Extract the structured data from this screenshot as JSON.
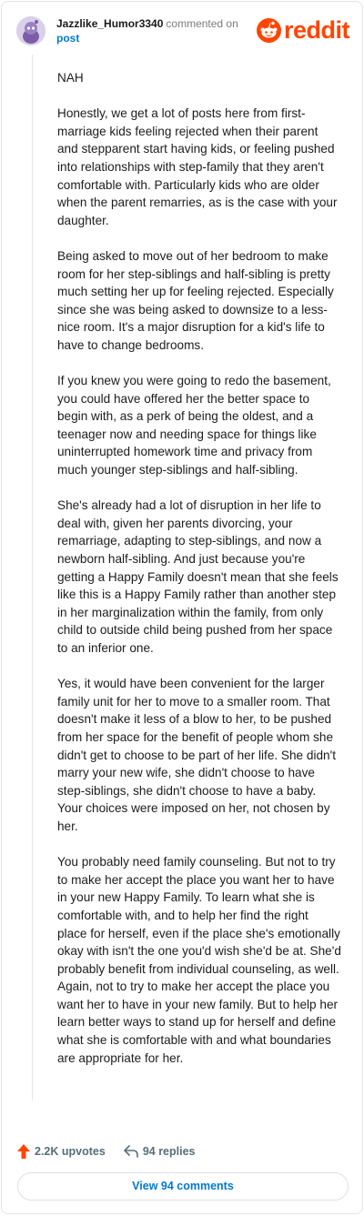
{
  "header": {
    "username": "Jazzlike_Humor3340",
    "commented_text": "commented on",
    "post_link": "post",
    "logo_text": "reddit"
  },
  "comment": {
    "paragraphs": [
      "NAH",
      "Honestly, we get a lot of posts here from first-marriage kids feeling rejected when their parent and stepparent start having kids, or feeling pushed into relationships with step-family that they aren't comfortable with. Particularly kids who are older when the parent remarries, as is the case with your daughter.",
      "Being asked to move out of her bedroom to make room for her step-siblings and half-sibling is pretty much setting her up for feeling rejected. Especially since she was being asked to downsize to a less-nice room. It's a major disruption for a kid's life to have to change bedrooms.",
      "If you knew you were going to redo the basement, you could have offered her the better space to begin with, as a perk of being the oldest, and a teenager now and needing space for things like uninterrupted homework time and privacy from much younger step-siblings and half-sibling.",
      "She's already had a lot of disruption in her life to deal with, given her parents divorcing, your remarriage, adapting to step-siblings, and now a newborn half-sibling. And just because you're getting a Happy Family doesn't mean that she feels like this is a Happy Family rather than another step in her marginalization within the family, from only child to outside child being pushed from her space to an inferior one.",
      "Yes, it would have been convenient for the larger family unit for her to move to a smaller room. That doesn't make it less of a blow to her, to be pushed from her space for the benefit of people whom she didn't get to choose to be part of her life. She didn't marry your new wife, she didn't choose to have step-siblings, she didn't choose to have a baby. Your choices were imposed on her, not chosen by her.",
      "You probably need family counseling. But not to try to make her accept the place you want her to have in your new Happy Family. To learn what she is comfortable with, and to help her find the right place for herself, even if the place she's emotionally okay with isn't the one you'd wish she'd be at. She'd probably benefit from individual counseling, as well. Again, not to try to make her accept the place you want her to have in your new family. But to help her learn better ways to stand up for herself and define what she is comfortable with and what boundaries are appropriate for her."
    ]
  },
  "actions": {
    "upvotes": "2.2K upvotes",
    "replies": "94 replies",
    "view_comments": "View 94 comments"
  },
  "colors": {
    "brand": "#ff4500",
    "link": "#0079d3",
    "muted": "#576f76"
  },
  "icons": [
    "avatar-icon",
    "reddit-snoo-icon",
    "upvote-arrow-icon",
    "reply-arrow-icon"
  ]
}
